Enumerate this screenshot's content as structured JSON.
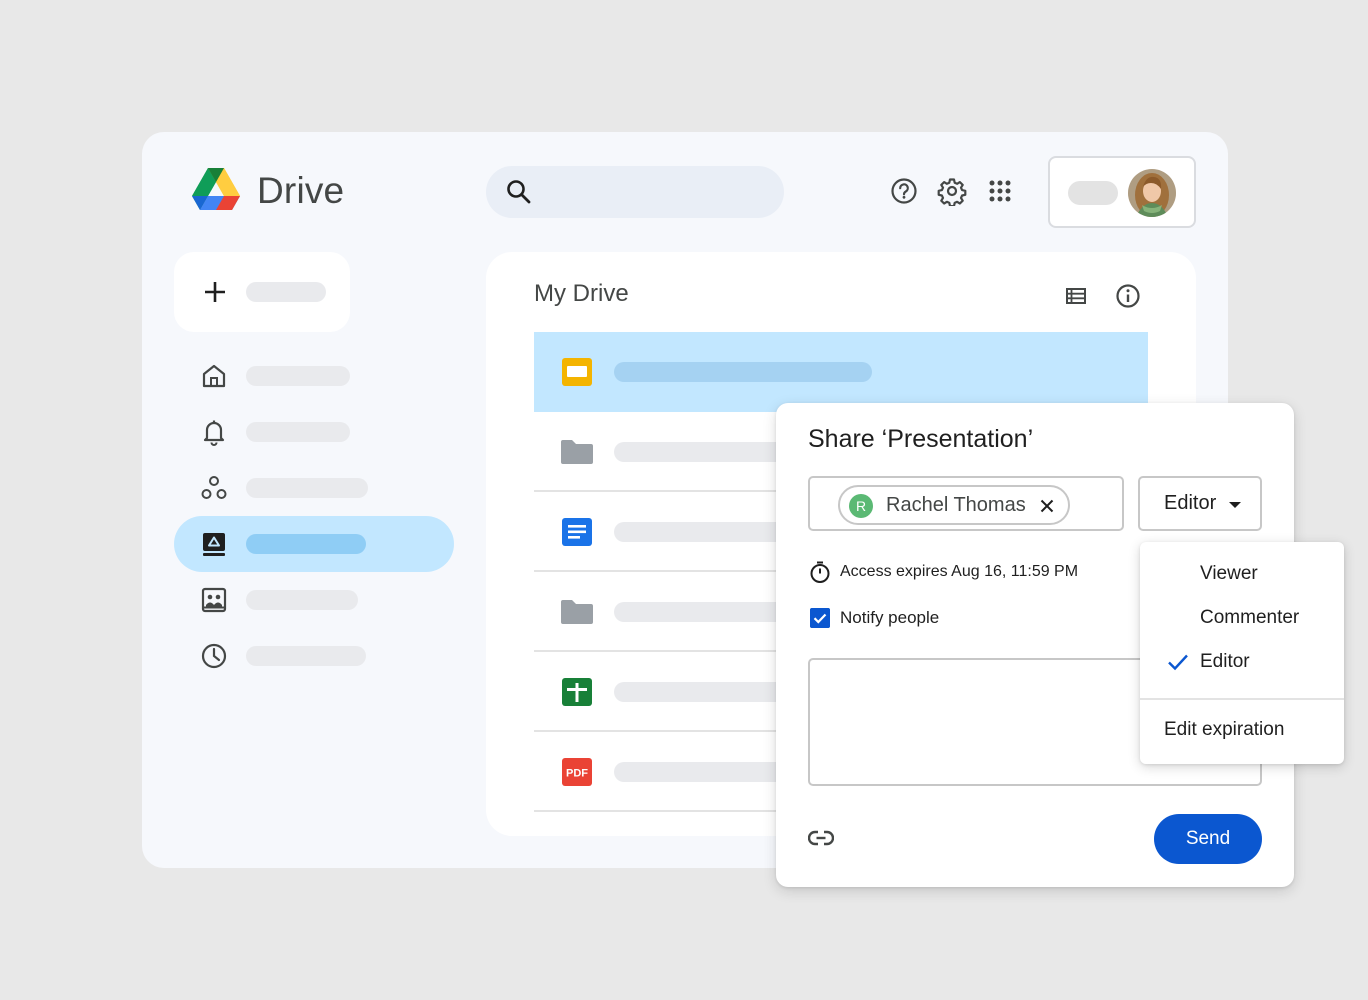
{
  "header": {
    "app_title": "Drive"
  },
  "main": {
    "title": "My Drive",
    "files": [
      {
        "type": "slides",
        "color": "#f4b400"
      },
      {
        "type": "folder",
        "color": "#9aa0a6"
      },
      {
        "type": "docs",
        "color": "#1a73e8"
      },
      {
        "type": "folder",
        "color": "#9aa0a6"
      },
      {
        "type": "sheets",
        "color": "#188038"
      },
      {
        "type": "pdf",
        "color": "#ea4335",
        "label": "PDF"
      }
    ]
  },
  "share_dialog": {
    "title": "Share ‘Presentation’",
    "person": {
      "initial": "R",
      "name": "Rachel Thomas"
    },
    "role": "Editor",
    "expiry": "Access expires Aug 16, 11:59 PM",
    "notify_label": "Notify people",
    "notify_checked": true,
    "send_label": "Send"
  },
  "role_menu": {
    "options": [
      {
        "label": "Viewer",
        "selected": false
      },
      {
        "label": "Commenter",
        "selected": false
      },
      {
        "label": "Editor",
        "selected": true
      }
    ],
    "edit_expiration_label": "Edit expiration"
  },
  "colors": {
    "accent": "#0b57d0",
    "selected_bg": "#c2e7ff",
    "app_bg": "#f6f8fc"
  }
}
